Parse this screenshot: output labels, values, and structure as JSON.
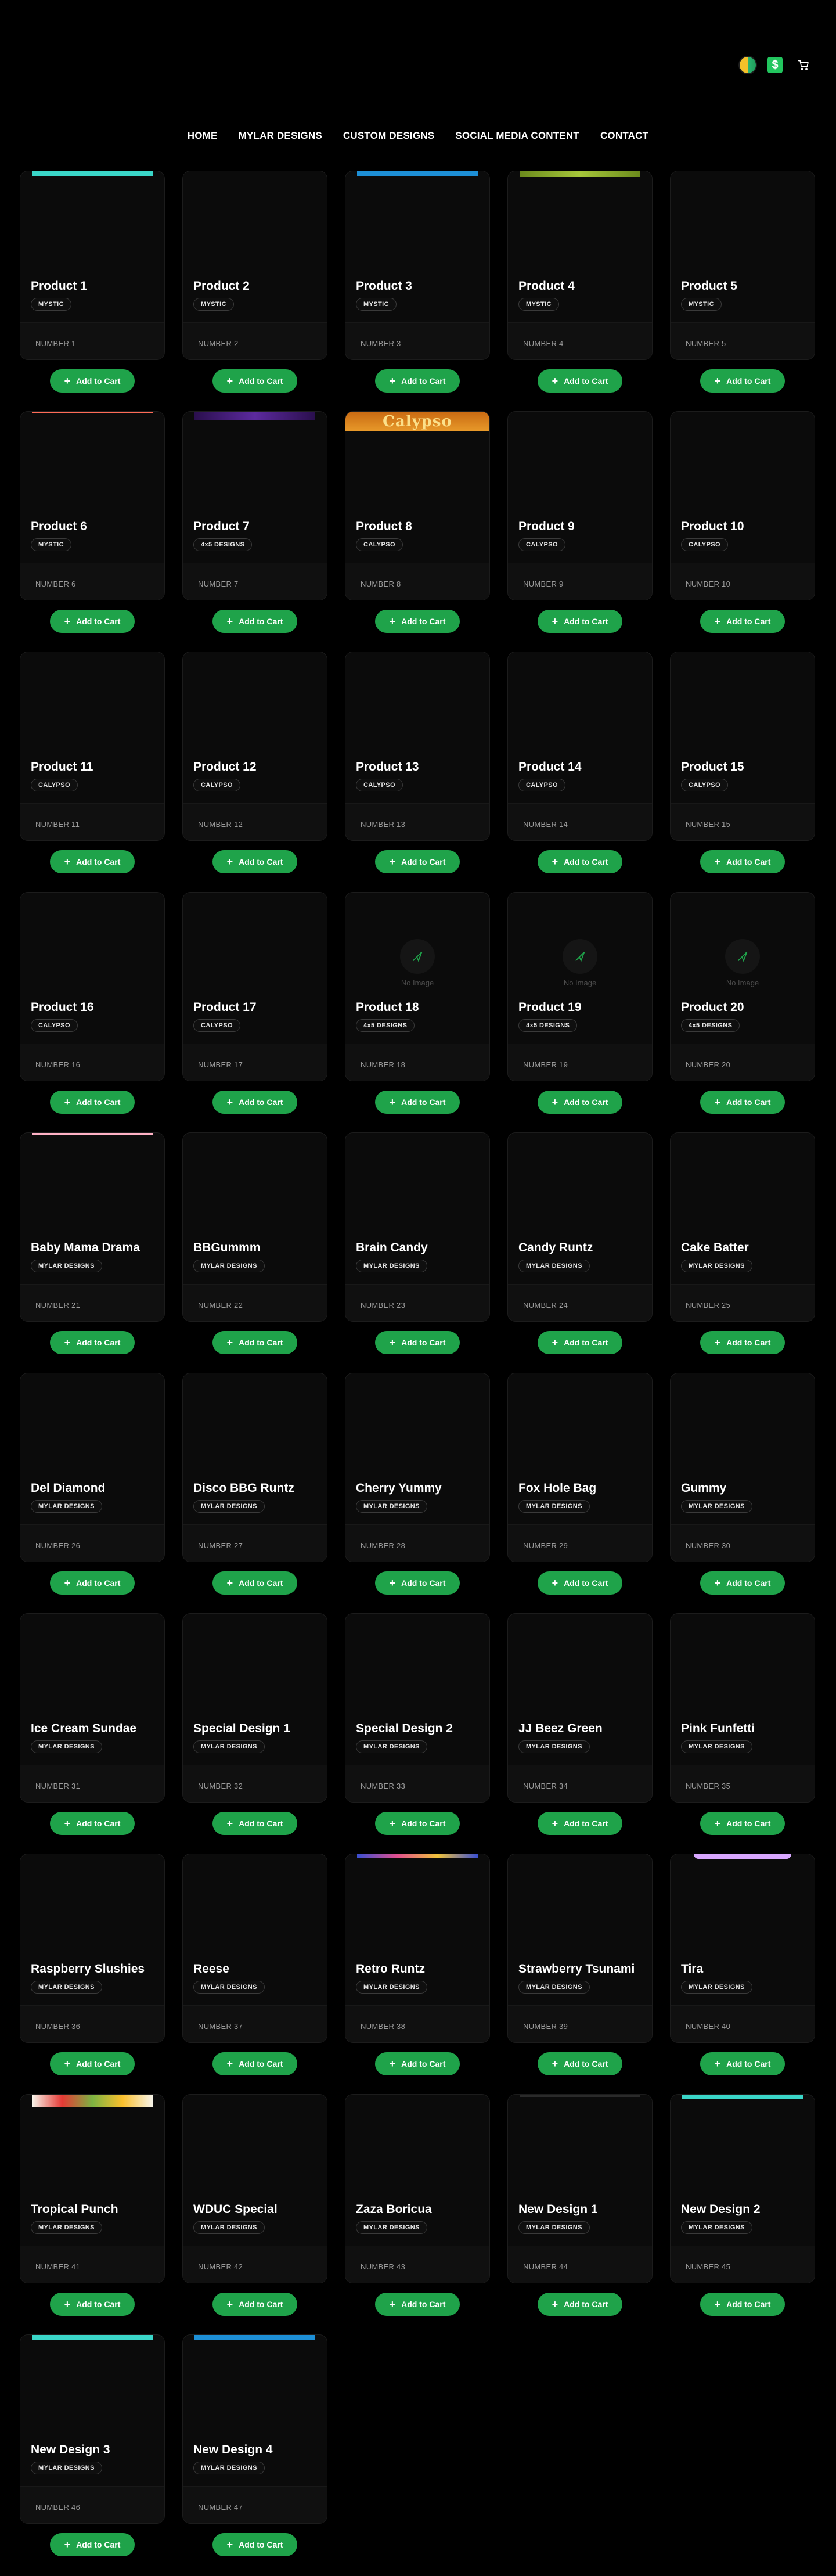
{
  "header": {
    "cart_icon": "cart-icon",
    "logo_icon": "brand-logo-icon",
    "money_icon": "dollar-icon",
    "money_symbol": "$"
  },
  "nav": {
    "items": [
      {
        "label": "HOME"
      },
      {
        "label": "MYLAR DESIGNS"
      },
      {
        "label": "CUSTOM DESIGNS"
      },
      {
        "label": "SOCIAL MEDIA CONTENT"
      },
      {
        "label": "CONTACT"
      }
    ]
  },
  "common": {
    "add_to_cart_label": "Add to Cart",
    "no_image_label": "No Image"
  },
  "colors": {
    "background": "#000000",
    "card": "#0c0c0c",
    "button": "#1fa34a"
  },
  "products": [
    {
      "title": "Product 1",
      "category": "MYSTIC",
      "number": "NUMBER 1",
      "thumb": "teal"
    },
    {
      "title": "Product 2",
      "category": "MYSTIC",
      "number": "NUMBER 2",
      "thumb": "none"
    },
    {
      "title": "Product 3",
      "category": "MYSTIC",
      "number": "NUMBER 3",
      "thumb": "blue"
    },
    {
      "title": "Product 4",
      "category": "MYSTIC",
      "number": "NUMBER 4",
      "thumb": "lime"
    },
    {
      "title": "Product 5",
      "category": "MYSTIC",
      "number": "NUMBER 5",
      "thumb": "none"
    },
    {
      "title": "Product 6",
      "category": "MYSTIC",
      "number": "NUMBER 6",
      "thumb": "salmon"
    },
    {
      "title": "Product 7",
      "category": "4x5 DESIGNS",
      "number": "NUMBER 7",
      "thumb": "purple"
    },
    {
      "title": "Product 8",
      "category": "CALYPSO",
      "number": "NUMBER 8",
      "thumb": "calypso",
      "thumb_text": "Calypso"
    },
    {
      "title": "Product 9",
      "category": "CALYPSO",
      "number": "NUMBER 9",
      "thumb": "none"
    },
    {
      "title": "Product 10",
      "category": "CALYPSO",
      "number": "NUMBER 10",
      "thumb": "none"
    },
    {
      "title": "Product 11",
      "category": "CALYPSO",
      "number": "NUMBER 11",
      "thumb": "none"
    },
    {
      "title": "Product 12",
      "category": "CALYPSO",
      "number": "NUMBER 12",
      "thumb": "none"
    },
    {
      "title": "Product 13",
      "category": "CALYPSO",
      "number": "NUMBER 13",
      "thumb": "none"
    },
    {
      "title": "Product 14",
      "category": "CALYPSO",
      "number": "NUMBER 14",
      "thumb": "none"
    },
    {
      "title": "Product 15",
      "category": "CALYPSO",
      "number": "NUMBER 15",
      "thumb": "none"
    },
    {
      "title": "Product 16",
      "category": "CALYPSO",
      "number": "NUMBER 16",
      "thumb": "none"
    },
    {
      "title": "Product 17",
      "category": "CALYPSO",
      "number": "NUMBER 17",
      "thumb": "none"
    },
    {
      "title": "Product 18",
      "category": "4x5 DESIGNS",
      "number": "NUMBER 18",
      "thumb": "noimage"
    },
    {
      "title": "Product 19",
      "category": "4x5 DESIGNS",
      "number": "NUMBER 19",
      "thumb": "noimage"
    },
    {
      "title": "Product 20",
      "category": "4x5 DESIGNS",
      "number": "NUMBER 20",
      "thumb": "noimage"
    },
    {
      "title": "Baby Mama Drama",
      "category": "MYLAR DESIGNS",
      "number": "NUMBER 21",
      "thumb": "pink"
    },
    {
      "title": "BBGummm",
      "category": "MYLAR DESIGNS",
      "number": "NUMBER 22",
      "thumb": "none"
    },
    {
      "title": "Brain Candy",
      "category": "MYLAR DESIGNS",
      "number": "NUMBER 23",
      "thumb": "none"
    },
    {
      "title": "Candy Runtz",
      "category": "MYLAR DESIGNS",
      "number": "NUMBER 24",
      "thumb": "none"
    },
    {
      "title": "Cake Batter",
      "category": "MYLAR DESIGNS",
      "number": "NUMBER 25",
      "thumb": "none"
    },
    {
      "title": "Del Diamond",
      "category": "MYLAR DESIGNS",
      "number": "NUMBER 26",
      "thumb": "none"
    },
    {
      "title": "Disco BBG Runtz",
      "category": "MYLAR DESIGNS",
      "number": "NUMBER 27",
      "thumb": "none"
    },
    {
      "title": "Cherry Yummy",
      "category": "MYLAR DESIGNS",
      "number": "NUMBER 28",
      "thumb": "none"
    },
    {
      "title": "Fox Hole Bag",
      "category": "MYLAR DESIGNS",
      "number": "NUMBER 29",
      "thumb": "none"
    },
    {
      "title": "Gummy",
      "category": "MYLAR DESIGNS",
      "number": "NUMBER 30",
      "thumb": "none"
    },
    {
      "title": "Ice Cream Sundae",
      "category": "MYLAR DESIGNS",
      "number": "NUMBER 31",
      "thumb": "none"
    },
    {
      "title": "Special Design 1",
      "category": "MYLAR DESIGNS",
      "number": "NUMBER 32",
      "thumb": "none"
    },
    {
      "title": "Special Design 2",
      "category": "MYLAR DESIGNS",
      "number": "NUMBER 33",
      "thumb": "none"
    },
    {
      "title": "JJ Beez Green",
      "category": "MYLAR DESIGNS",
      "number": "NUMBER 34",
      "thumb": "none"
    },
    {
      "title": "Pink Funfetti",
      "category": "MYLAR DESIGNS",
      "number": "NUMBER 35",
      "thumb": "none"
    },
    {
      "title": "Raspberry Slushies",
      "category": "MYLAR DESIGNS",
      "number": "NUMBER 36",
      "thumb": "none"
    },
    {
      "title": "Reese",
      "category": "MYLAR DESIGNS",
      "number": "NUMBER 37",
      "thumb": "none"
    },
    {
      "title": "Retro Runtz",
      "category": "MYLAR DESIGNS",
      "number": "NUMBER 38",
      "thumb": "retro"
    },
    {
      "title": "Strawberry Tsunami",
      "category": "MYLAR DESIGNS",
      "number": "NUMBER 39",
      "thumb": "none"
    },
    {
      "title": "Tira",
      "category": "MYLAR DESIGNS",
      "number": "NUMBER 40",
      "thumb": "lavender"
    },
    {
      "title": "Tropical Punch",
      "category": "MYLAR DESIGNS",
      "number": "NUMBER 41",
      "thumb": "fruit"
    },
    {
      "title": "WDUC Special",
      "category": "MYLAR DESIGNS",
      "number": "NUMBER 42",
      "thumb": "none"
    },
    {
      "title": "Zaza Boricua",
      "category": "MYLAR DESIGNS",
      "number": "NUMBER 43",
      "thumb": "none"
    },
    {
      "title": "New Design 1",
      "category": "MYLAR DESIGNS",
      "number": "NUMBER 44",
      "thumb": "dark"
    },
    {
      "title": "New Design 2",
      "category": "MYLAR DESIGNS",
      "number": "NUMBER 45",
      "thumb": "teal"
    },
    {
      "title": "New Design 3",
      "category": "MYLAR DESIGNS",
      "number": "NUMBER 46",
      "thumb": "teal"
    },
    {
      "title": "New Design 4",
      "category": "MYLAR DESIGNS",
      "number": "NUMBER 47",
      "thumb": "blue"
    }
  ]
}
